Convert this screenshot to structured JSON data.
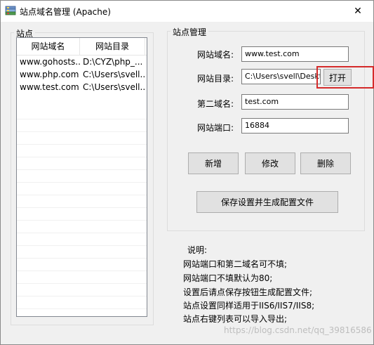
{
  "window": {
    "title": "站点域名管理 (Apache)",
    "close_symbol": "✕"
  },
  "sites_group": {
    "caption": "站点",
    "columns": [
      "网站域名",
      "网站目录"
    ],
    "rows": [
      [
        "www.gohosts....",
        "D:\\CYZ\\php_..."
      ],
      [
        "www.php.com",
        "C:\\Users\\svell..."
      ],
      [
        "www.test.com",
        "C:\\Users\\svell..."
      ]
    ]
  },
  "manage_group": {
    "caption": "站点管理",
    "domain_label": "网站域名:",
    "domain_value": "www.test.com",
    "dir_label": "网站目录:",
    "dir_value": "C:\\Users\\svell\\Desktop",
    "open_button": "打开",
    "second_domain_label": "第二域名:",
    "second_domain_value": "test.com",
    "port_label": "网站端口:",
    "port_value": "16884",
    "add_button": "新增",
    "edit_button": "修改",
    "delete_button": "删除",
    "save_button": "保存设置并生成配置文件"
  },
  "notes": {
    "title": "说明:",
    "lines": [
      "网站端口和第二域名可不填;",
      "网站端口不填默认为80;",
      "设置后请点保存按钮生成配置文件;",
      "站点设置同样适用于IIS6/IIS7/IIS8;",
      "站点右键列表可以导入导出;"
    ]
  },
  "watermark": "https://blog.csdn.net/qq_39816586",
  "colors": {
    "highlight_border": "#d42a2a",
    "dialog_bg": "#f0f0f0"
  }
}
